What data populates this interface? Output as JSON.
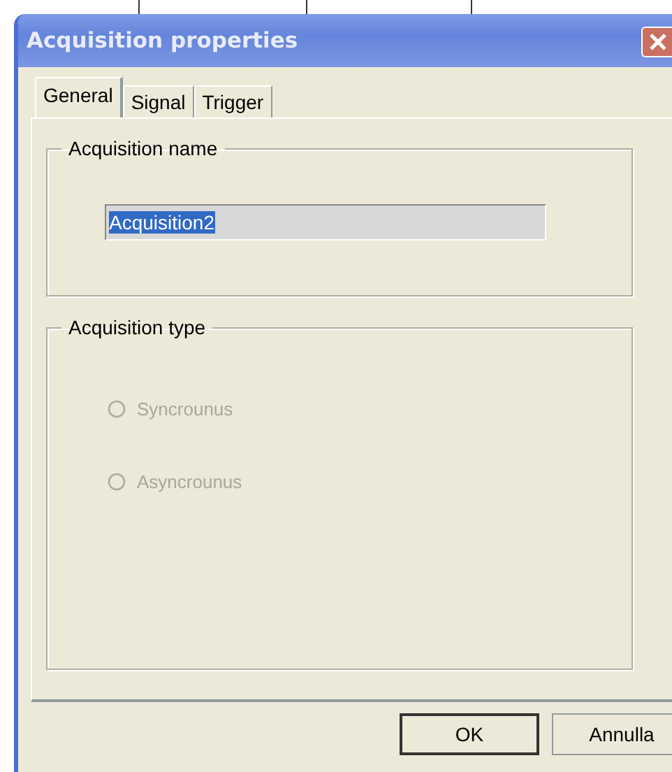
{
  "window": {
    "title": "Acquisition properties"
  },
  "tabs": [
    {
      "label": "General",
      "selected": true
    },
    {
      "label": "Signal",
      "selected": false
    },
    {
      "label": "Trigger",
      "selected": false
    }
  ],
  "name_group": {
    "title": "Acquisition name",
    "field": {
      "value": "Acquisition2",
      "highlighted": true
    }
  },
  "type_group": {
    "title": "Acquisition type",
    "options": [
      {
        "label": "Syncrounus",
        "selected": false,
        "disabled": true
      },
      {
        "label": "Asyncrounus",
        "selected": false,
        "disabled": true
      }
    ]
  },
  "buttons": [
    {
      "label": "OK",
      "default": true
    },
    {
      "label": "Annulla",
      "default": false
    }
  ]
}
